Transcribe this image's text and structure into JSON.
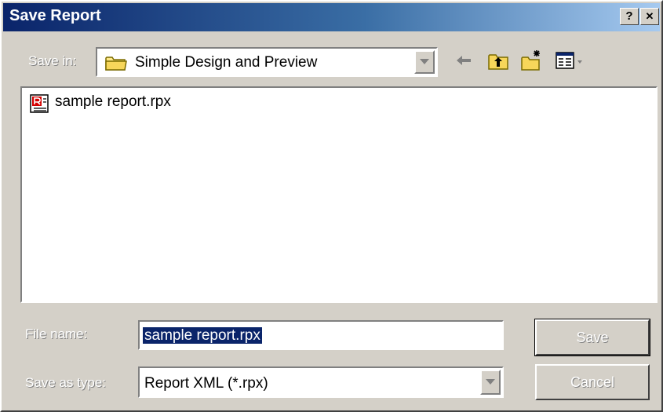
{
  "window": {
    "title": "Save Report",
    "help_glyph": "?",
    "close_glyph": "✕"
  },
  "save_in": {
    "label": "Save in:",
    "value": "Simple Design and Preview",
    "icon": "folder-icon"
  },
  "toolbar": {
    "back_icon": "back-arrow-icon",
    "up_icon": "up-one-level-icon",
    "new_folder_icon": "new-folder-icon",
    "view_menu_icon": "view-menu-icon"
  },
  "files": [
    {
      "name": "sample report.rpx",
      "icon": "report-file-icon"
    }
  ],
  "file_name": {
    "label": "File name:",
    "value": "sample report.rpx"
  },
  "save_as_type": {
    "label": "Save as type:",
    "value": "Report XML (*.rpx)"
  },
  "buttons": {
    "save": "Save",
    "cancel": "Cancel"
  },
  "colors": {
    "title_start": "#0a246a",
    "title_end": "#a6caf0",
    "face": "#d4d0c8",
    "selection": "#0a246a"
  }
}
